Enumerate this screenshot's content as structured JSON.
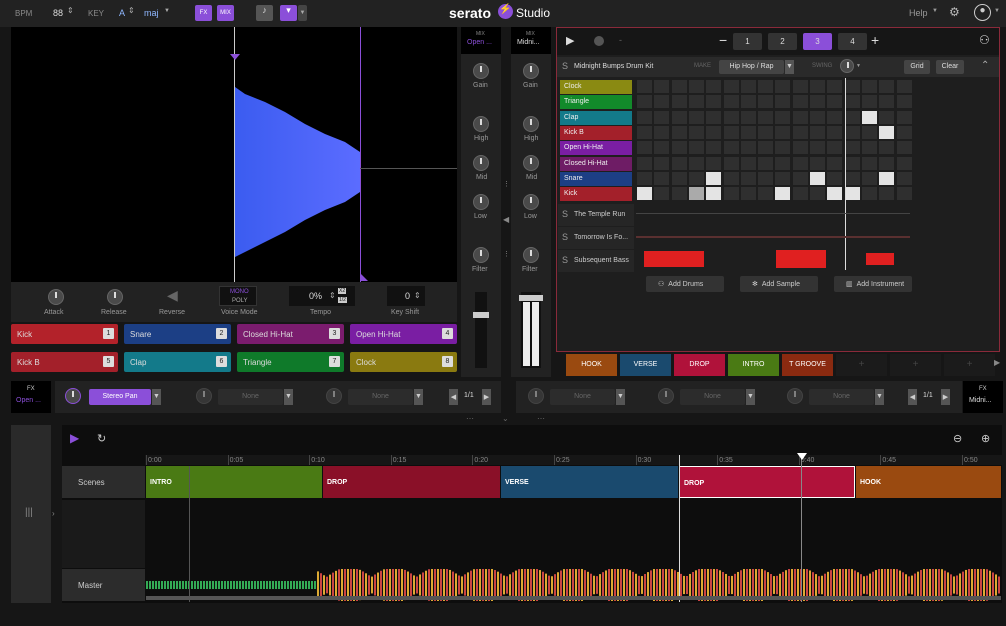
{
  "top": {
    "bpm_label": "BPM",
    "bpm": "88",
    "key_label": "KEY",
    "key": "A",
    "scale": "maj",
    "fx": "FX",
    "mix": "MIX",
    "brand": "serato",
    "brand2": "Studio",
    "help": "Help"
  },
  "deck": {
    "attack": "Attack",
    "release": "Release",
    "reverse": "Reverse",
    "voice_mode": "Voice Mode",
    "mono": "MONO",
    "poly": "POLY",
    "tempo": "Tempo",
    "tempo_val": "0%",
    "x2": "X2",
    "half": "1/2",
    "key_shift": "Key Shift",
    "key_shift_val": "0"
  },
  "pads": [
    {
      "label": "Kick",
      "num": "1",
      "color": "#b3222a"
    },
    {
      "label": "Snare",
      "num": "2",
      "color": "#1c3f85"
    },
    {
      "label": "Closed Hi-Hat",
      "num": "3",
      "color": "#7b1c6e"
    },
    {
      "label": "Open Hi-Hat",
      "num": "4",
      "color": "#7a1ea3"
    },
    {
      "label": "Kick B",
      "num": "5",
      "color": "#a3202a"
    },
    {
      "label": "Clap",
      "num": "6",
      "color": "#137a8a"
    },
    {
      "label": "Triangle",
      "num": "7",
      "color": "#0f7a2a"
    },
    {
      "label": "Clock",
      "num": "8",
      "color": "#8a7a10"
    }
  ],
  "mixer": {
    "mix": "MIX",
    "left_name": "Open ...",
    "right_name": "Midni...",
    "gain": "Gain",
    "high": "High",
    "mid": "Mid",
    "low": "Low",
    "filter": "Filter"
  },
  "fx": {
    "label": "FX",
    "left_name": "Open ...",
    "right_name": "Midni...",
    "stereo_pan": "Stereo Pan",
    "none": "None",
    "page": "1/1"
  },
  "patterns": [
    "1",
    "2",
    "3",
    "4"
  ],
  "drum": {
    "kit": "Midnight Bumps Drum Kit",
    "make": "MAKE",
    "genre": "Hip Hop / Rap",
    "swing": "SWING",
    "grid": "Grid",
    "clear": "Clear"
  },
  "tracks": [
    {
      "name": "Clock",
      "color": "#8a8a12"
    },
    {
      "name": "Triangle",
      "color": "#128a2a"
    },
    {
      "name": "Clap",
      "color": "#137a8a"
    },
    {
      "name": "Kick B",
      "color": "#a3202a"
    },
    {
      "name": "Open Hi-Hat",
      "color": "#7a1ea3"
    },
    {
      "name": "Closed Hi-Hat",
      "color": "#6e1c65"
    },
    {
      "name": "Snare",
      "color": "#1c3f85"
    },
    {
      "name": "Kick",
      "color": "#a3202a"
    }
  ],
  "samples": [
    "The Temple Run",
    "Tomorrow Is Fo...",
    "Subsequent Bass"
  ],
  "adds": [
    "Add Drums",
    "Add Sample",
    "Add Instrument"
  ],
  "scenes": [
    {
      "label": "HOOK",
      "color": "#9a4a10"
    },
    {
      "label": "VERSE",
      "color": "#1a4a6e"
    },
    {
      "label": "DROP",
      "color": "#b0123a"
    },
    {
      "label": "INTRO",
      "color": "#4a7a14"
    },
    {
      "label": "T GROOVE",
      "color": "#8a2a10"
    }
  ],
  "arr": {
    "scenes": "Scenes",
    "master": "Master",
    "ticks": [
      "0:00",
      "0:05",
      "0:10",
      "0:15",
      "0:20",
      "0:25",
      "0:30",
      "0:35",
      "0:40",
      "0:45",
      "0:50"
    ],
    "sections": [
      {
        "label": "INTRO",
        "color": "#4a7a14"
      },
      {
        "label": "DROP",
        "color": "#8a1028"
      },
      {
        "label": "VERSE",
        "color": "#1a4a6e"
      },
      {
        "label": "DROP",
        "color": "#b0123a"
      },
      {
        "label": "HOOK",
        "color": "#9a4a10"
      }
    ]
  }
}
